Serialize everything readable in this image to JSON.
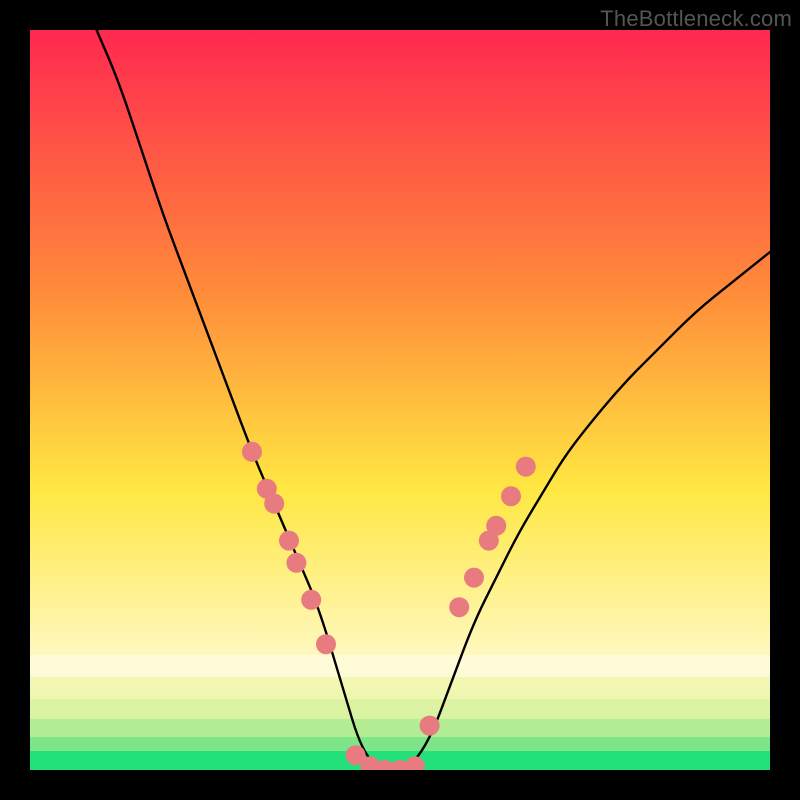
{
  "watermark": "TheBottleneck.com",
  "chart_data": {
    "type": "line",
    "title": "",
    "xlabel": "",
    "ylabel": "",
    "xlim": [
      0,
      100
    ],
    "ylim": [
      0,
      100
    ],
    "background_gradient": {
      "top": "#ff2850",
      "mid": "#ffe742",
      "bottom": "#22e07a",
      "bottom_band_top": "#fff9c7"
    },
    "curve": {
      "description": "V-shaped bottleneck curve, minimum near x≈47, flat at y≈0 around x 42–52",
      "x": [
        9,
        12,
        15,
        18,
        21,
        24,
        27,
        30,
        33,
        36,
        39,
        42,
        45,
        48,
        51,
        54,
        57,
        60,
        63,
        66,
        69,
        72,
        75,
        80,
        85,
        90,
        95,
        100
      ],
      "y": [
        100,
        93,
        84,
        75,
        67,
        59,
        51,
        43,
        36,
        29,
        22,
        12,
        2,
        0,
        0,
        4,
        12,
        20,
        26,
        32,
        37,
        42,
        46,
        52,
        57,
        62,
        66,
        70
      ]
    },
    "markers": {
      "color": "#e77b7f",
      "radius": 10,
      "points": [
        {
          "x": 30,
          "y": 43
        },
        {
          "x": 32,
          "y": 38
        },
        {
          "x": 33,
          "y": 36
        },
        {
          "x": 35,
          "y": 31
        },
        {
          "x": 36,
          "y": 28
        },
        {
          "x": 38,
          "y": 23
        },
        {
          "x": 40,
          "y": 17
        },
        {
          "x": 44,
          "y": 2
        },
        {
          "x": 46,
          "y": 0.5
        },
        {
          "x": 48,
          "y": 0
        },
        {
          "x": 50,
          "y": 0
        },
        {
          "x": 52,
          "y": 0.5
        },
        {
          "x": 54,
          "y": 6
        },
        {
          "x": 58,
          "y": 22
        },
        {
          "x": 60,
          "y": 26
        },
        {
          "x": 62,
          "y": 31
        },
        {
          "x": 63,
          "y": 33
        },
        {
          "x": 65,
          "y": 37
        },
        {
          "x": 67,
          "y": 41
        }
      ]
    }
  }
}
